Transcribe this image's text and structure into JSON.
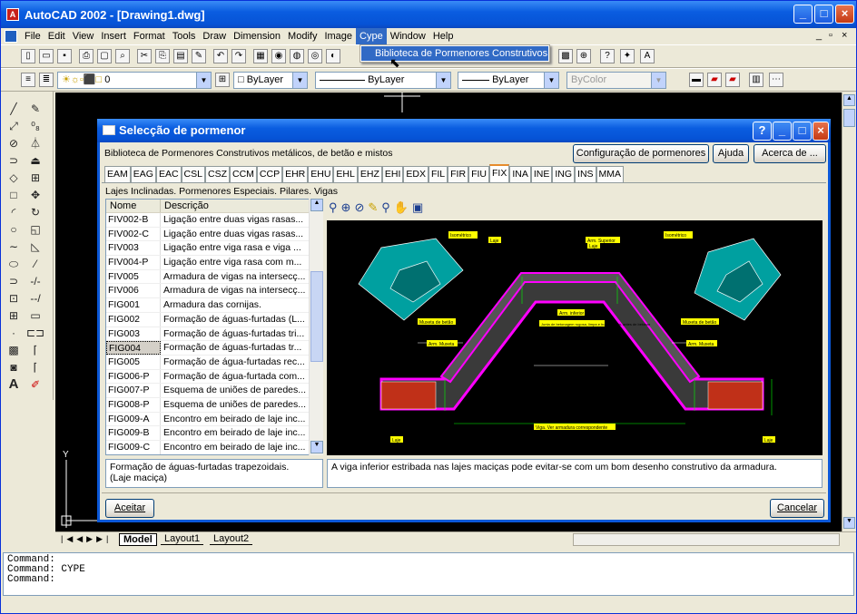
{
  "app": {
    "title": "AutoCAD 2002 - [Drawing1.dwg]"
  },
  "menu": [
    "File",
    "Edit",
    "View",
    "Insert",
    "Format",
    "Tools",
    "Draw",
    "Dimension",
    "Modify",
    "Image",
    "Cype",
    "Window",
    "Help"
  ],
  "dropdown": {
    "item": "Biblioteca de Pormenores Construtivos"
  },
  "toolbar": {
    "layer_value": "0",
    "color_value": "ByLayer",
    "linetype_value": "ByLayer",
    "lineweight_value": "ByLayer",
    "plotstyle_value": "ByColor"
  },
  "dialog": {
    "title": "Selecção de pormenor",
    "subtitle": "Biblioteca de Pormenores Construtivos metálicos, de betão e mistos",
    "btn_config": "Configuração de pormenores",
    "btn_help": "Ajuda",
    "btn_about": "Acerca de ...",
    "tabs": [
      "EAM",
      "EAG",
      "EAC",
      "CSL",
      "CSZ",
      "CCM",
      "CCP",
      "EHR",
      "EHU",
      "EHL",
      "EHZ",
      "EHI",
      "EDX",
      "FIL",
      "FIR",
      "FIU",
      "FIX",
      "INA",
      "INE",
      "ING",
      "INS",
      "MMA"
    ],
    "selected_tab": "FIX",
    "section_caption": "Lajes Inclinadas. Pormenores Especiais. Pilares. Vigas",
    "col_name": "Nome",
    "col_desc": "Descrição",
    "rows": [
      {
        "name": "FIV002-B",
        "desc": "Ligação entre duas vigas rasas..."
      },
      {
        "name": "FIV002-C",
        "desc": "Ligação entre duas vigas rasas..."
      },
      {
        "name": "FIV003",
        "desc": "Ligação entre viga rasa e viga ..."
      },
      {
        "name": "FIV004-P",
        "desc": "Ligação entre viga rasa com m..."
      },
      {
        "name": "FIV005",
        "desc": "Armadura de vigas na intersecç..."
      },
      {
        "name": "FIV006",
        "desc": "Armadura de vigas na intersecç..."
      },
      {
        "name": "FIG001",
        "desc": "Armadura das cornijas."
      },
      {
        "name": "FIG002",
        "desc": "Formação de águas-furtadas (L..."
      },
      {
        "name": "FIG003",
        "desc": "Formação de águas-furtadas tri..."
      },
      {
        "name": "FIG004",
        "desc": "Formação de águas-furtadas tr..."
      },
      {
        "name": "FIG005",
        "desc": "Formação de água-furtadas rec..."
      },
      {
        "name": "FIG006-P",
        "desc": "Formação de água-furtada com..."
      },
      {
        "name": "FIG007-P",
        "desc": "Esquema de uniões de paredes..."
      },
      {
        "name": "FIG008-P",
        "desc": "Esquema de uniões de paredes..."
      },
      {
        "name": "FIG009-A",
        "desc": "Encontro em beirado de laje inc..."
      },
      {
        "name": "FIG009-B",
        "desc": "Encontro em beirado de laje inc..."
      },
      {
        "name": "FIG009-C",
        "desc": "Encontro em beirado de laje inc..."
      }
    ],
    "selected_row": "FIG004",
    "desc_left": "Formação de águas-furtadas trapezoidais.\n(Laje maciça)",
    "desc_right": "A viga inferior estribada nas lajes maciças pode evitar-se com um bom desenho construtivo da armadura.",
    "btn_accept": "Aceitar",
    "btn_cancel": "Cancelar",
    "preview_labels": {
      "iso_left": "Isométrico",
      "iso_right": "Isométrico",
      "laje": "Laje",
      "arm_sup": "Arm. Superior",
      "laje2": "Laje",
      "muxeta_l": "Muxeta de betão",
      "muxeta_r": "Muxeta de betão",
      "arm_inf": "Arm. inferior",
      "junta": "Junta de betonagem rugosa, limpa e humedecida, antes de betonar",
      "arm_muxeta_l": "Arm. Muxeta",
      "arm_muxeta_r": "Arm. Muxeta",
      "viga": "Viga. Ver armadura correspondente",
      "laje_bl": "Laje",
      "laje_br": "Laje"
    }
  },
  "layout_tabs": [
    "Model",
    "Layout1",
    "Layout2"
  ],
  "command_lines": [
    "Command:",
    "Command:  CYPE",
    "Command:"
  ]
}
